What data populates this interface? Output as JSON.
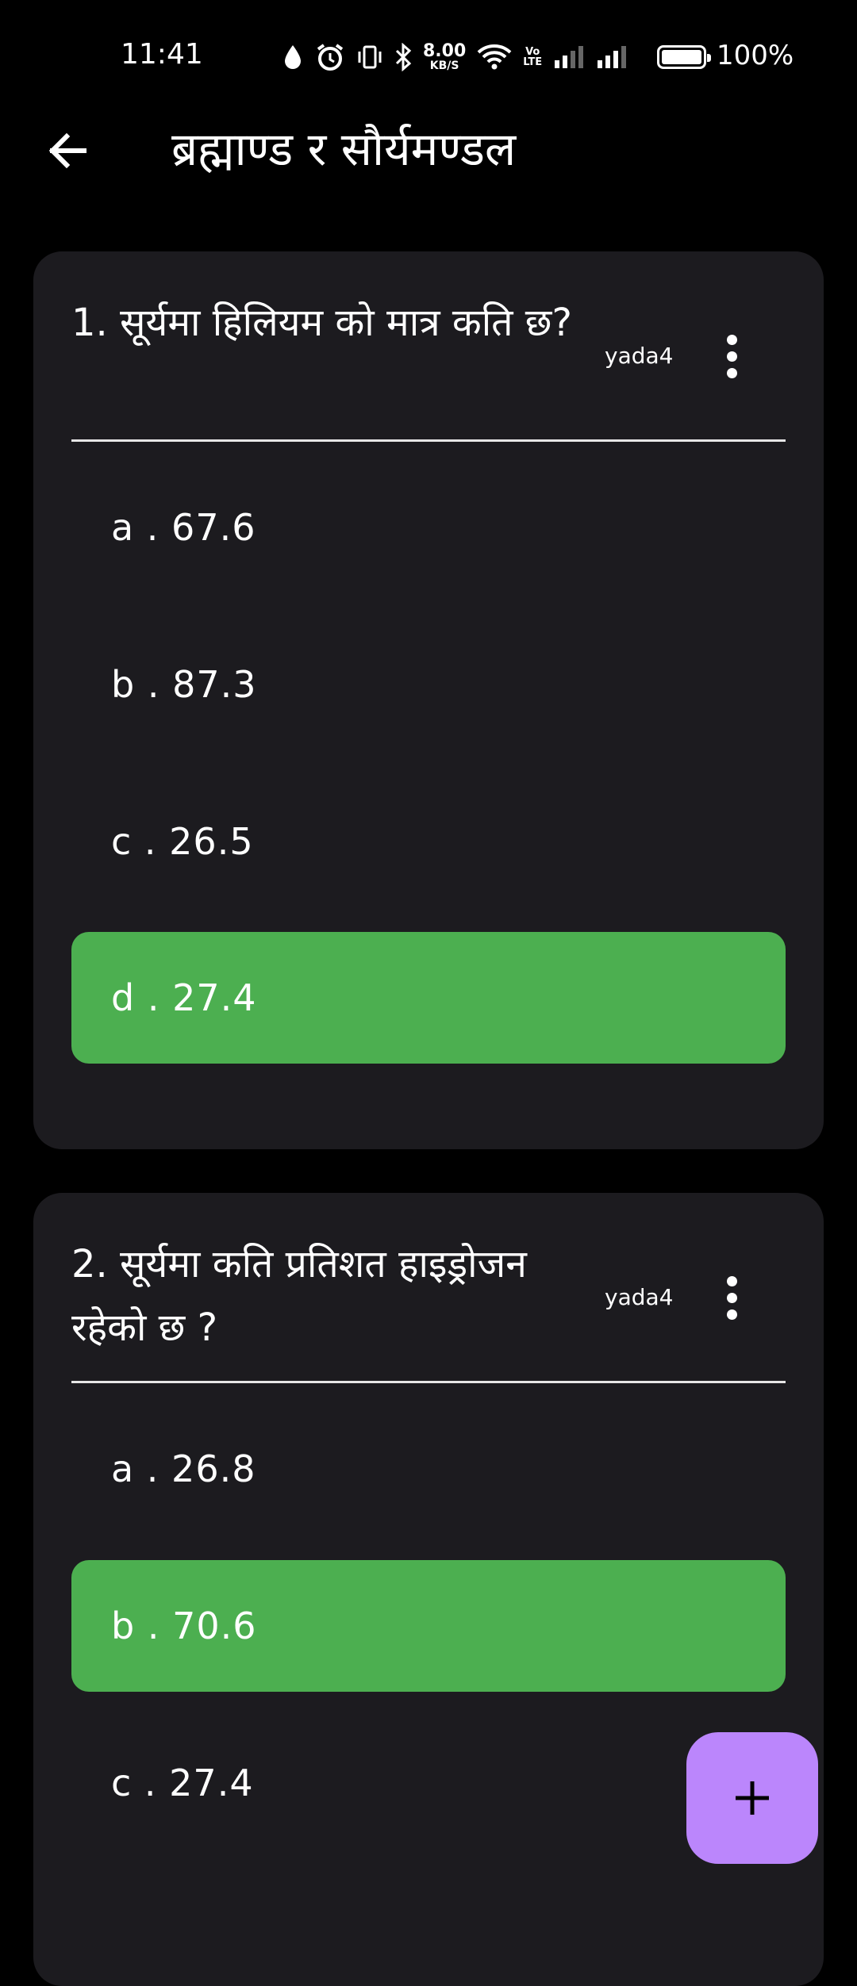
{
  "status_bar": {
    "time": "11:41",
    "speed_value": "8.00",
    "speed_unit": "KB/S",
    "volte_line1": "Vo",
    "volte_line2": "LTE",
    "battery_percent": "100%"
  },
  "app_bar": {
    "title": "ब्रह्माण्ड र सौर्यमण्डल",
    "back_icon": "arrow-left-icon"
  },
  "questions": [
    {
      "text": "1. सूर्यमा हिलियम को मात्र कति छ?",
      "author": "yada4",
      "options": [
        "a . 67.6",
        "b . 87.3",
        "c . 26.5",
        "d . 27.4"
      ],
      "correct_index": 3
    },
    {
      "text": "2. सूर्यमा कति प्रतिशत हाइड्रोजन रहेको छ ?",
      "author": "yada4",
      "options": [
        "a . 26.8",
        "b . 70.6",
        "c . 27.4"
      ],
      "correct_index": 1
    }
  ],
  "colors": {
    "background": "#000000",
    "card": "#1c1b1f",
    "correct": "#4caf50",
    "fab": "#bb86fc"
  },
  "fab": {
    "icon": "plus-icon"
  }
}
